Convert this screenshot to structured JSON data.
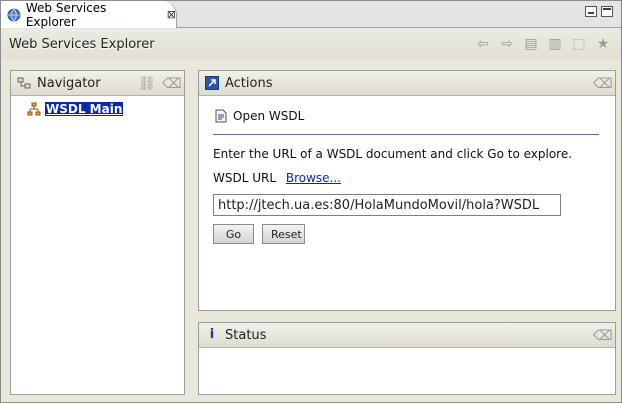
{
  "tab": {
    "label": "Web Services Explorer",
    "close": "⊠"
  },
  "title": "Web Services Explorer",
  "navigator": {
    "title": "Navigator",
    "items": [
      {
        "label": "WSDL Main"
      }
    ]
  },
  "actions": {
    "title": "Actions",
    "action_title": "Open WSDL",
    "description": "Enter the URL of a WSDL document and click Go to explore.",
    "url_label": "WSDL URL",
    "browse_label": "Browse...",
    "url_value": "http://jtech.ua.es:80/HolaMundoMovil/hola?WSDL",
    "go_label": "Go",
    "reset_label": "Reset"
  },
  "status": {
    "title": "Status"
  },
  "colors": {
    "selection": "#0b2aa8",
    "accent": "#5b6f9a"
  }
}
